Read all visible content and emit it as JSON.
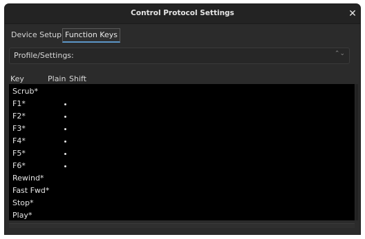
{
  "window": {
    "title": "Control Protocol Settings",
    "close_glyph": "✕"
  },
  "tabs": [
    {
      "label": "Device Setup",
      "selected": false
    },
    {
      "label": "Function Keys",
      "selected": true
    }
  ],
  "profile": {
    "label": "Profile/Settings:",
    "chevron": "⌃⌄"
  },
  "table": {
    "columns": [
      "Key",
      "Plain",
      "Shift"
    ],
    "rows": [
      {
        "key": "Scrub*",
        "plain_mark": false
      },
      {
        "key": "F1*",
        "plain_mark": true
      },
      {
        "key": "F2*",
        "plain_mark": true
      },
      {
        "key": "F3*",
        "plain_mark": true
      },
      {
        "key": "F4*",
        "plain_mark": true
      },
      {
        "key": "F5*",
        "plain_mark": true
      },
      {
        "key": "F6*",
        "plain_mark": true
      },
      {
        "key": "Rewind*",
        "plain_mark": false
      },
      {
        "key": "Fast Fwd*",
        "plain_mark": false
      },
      {
        "key": "Stop*",
        "plain_mark": false
      },
      {
        "key": "Play*",
        "plain_mark": false
      }
    ]
  },
  "colors": {
    "window_bg": "#2b2b2b",
    "titlebar_bg": "#232323",
    "table_bg": "#000000",
    "text": "#e6e6e6",
    "tab_accent": "#5d98c9"
  }
}
